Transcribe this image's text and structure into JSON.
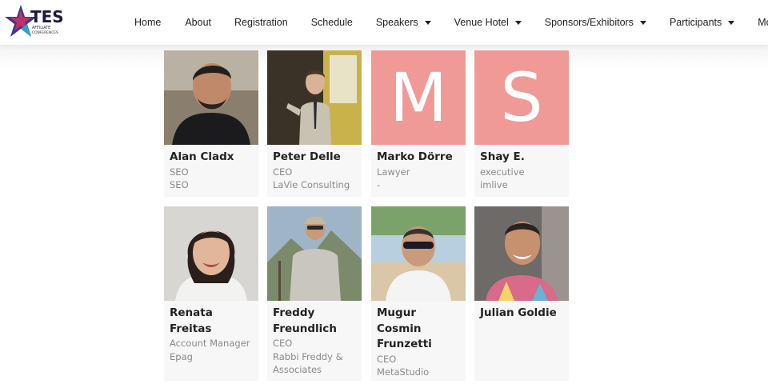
{
  "logo": {
    "text": "TES",
    "sub1": "AFFILIATE",
    "sub2": "CONFERENCES"
  },
  "nav": [
    {
      "label": "Home"
    },
    {
      "label": "About"
    },
    {
      "label": "Registration"
    },
    {
      "label": "Schedule"
    },
    {
      "label": "Speakers"
    },
    {
      "label": "Venue Hotel"
    },
    {
      "label": "Sponsors/Exhibitors"
    },
    {
      "label": "Participants"
    },
    {
      "label": "More"
    }
  ],
  "participants": [
    {
      "name": "Alan Cladx",
      "title": "SEO",
      "company": "SEO"
    },
    {
      "name": "Peter Delle",
      "title": "CEO",
      "company": "LaVie Consulting"
    },
    {
      "name": "Marko Dörre",
      "title": "Lawyer",
      "company": "-",
      "initial": "M"
    },
    {
      "name": "Shay E.",
      "title": "executive",
      "company": "imlive",
      "initial": "S"
    },
    {
      "name": "Renata Freitas",
      "title": "Account Manager",
      "company": "Epag"
    },
    {
      "name": "Freddy Freundlich",
      "title": "CEO",
      "company": "Rabbi Freddy & Associates"
    },
    {
      "name": "Mugur Cosmin Frunzetti",
      "title": "CEO",
      "company": "MetaStudio"
    },
    {
      "name": "Julian Goldie",
      "title": "",
      "company": ""
    }
  ],
  "colors": {
    "placeholder": "#f09a98",
    "card_bg": "#f7f7f7",
    "muted_text": "#8a8a8a"
  }
}
